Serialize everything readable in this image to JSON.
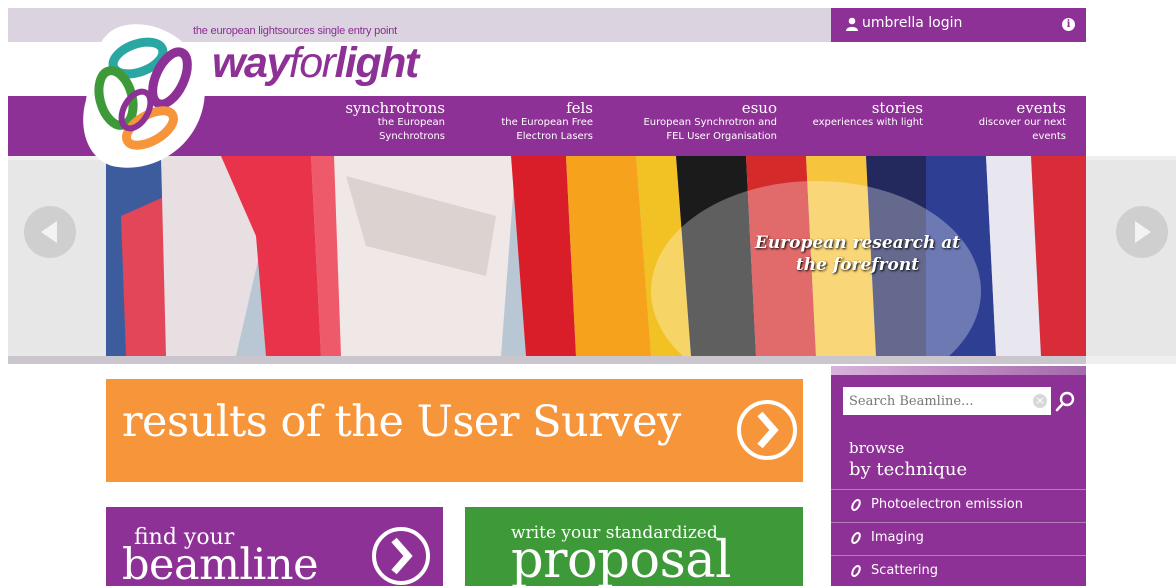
{
  "header": {
    "tagline": "the european lightsources single entry point",
    "brand_way": "way",
    "brand_for": "for",
    "brand_light": "light",
    "login_label": "umbrella login",
    "info_glyph": "i",
    "login_icon": "user-icon",
    "colors": {
      "purple": "#8e3196",
      "strip": "#dcd3e0",
      "orange": "#f7953b",
      "green": "#3e9a39"
    }
  },
  "nav": [
    {
      "title": "synchrotrons",
      "sub1": "the European",
      "sub2": "Synchrotrons"
    },
    {
      "title": "fels",
      "sub1": "the European Free",
      "sub2": "Electron Lasers"
    },
    {
      "title": "esuo",
      "sub1": "European Synchrotron and",
      "sub2": "FEL User Organisation"
    },
    {
      "title": "stories",
      "sub1": "experiences with light",
      "sub2": ""
    },
    {
      "title": "events",
      "sub1": "discover our next",
      "sub2": "events"
    }
  ],
  "slider": {
    "caption_line1": "European research at",
    "caption_line2": "the forefront",
    "prev_icon": "arrow-left-icon",
    "next_icon": "arrow-right-icon"
  },
  "promos": {
    "survey": "results of the User Survey",
    "beamline_line1": "find your",
    "beamline_line2": "beamline",
    "proposal_line1": "write your standardized",
    "proposal_line2": "proposal"
  },
  "sidebar": {
    "search_placeholder": "Search Beamline...",
    "clear_glyph": "×",
    "browse_line1": "browse",
    "browse_line2": "by technique",
    "techniques": [
      "Photoelectron emission",
      "Imaging",
      "Scattering"
    ]
  }
}
